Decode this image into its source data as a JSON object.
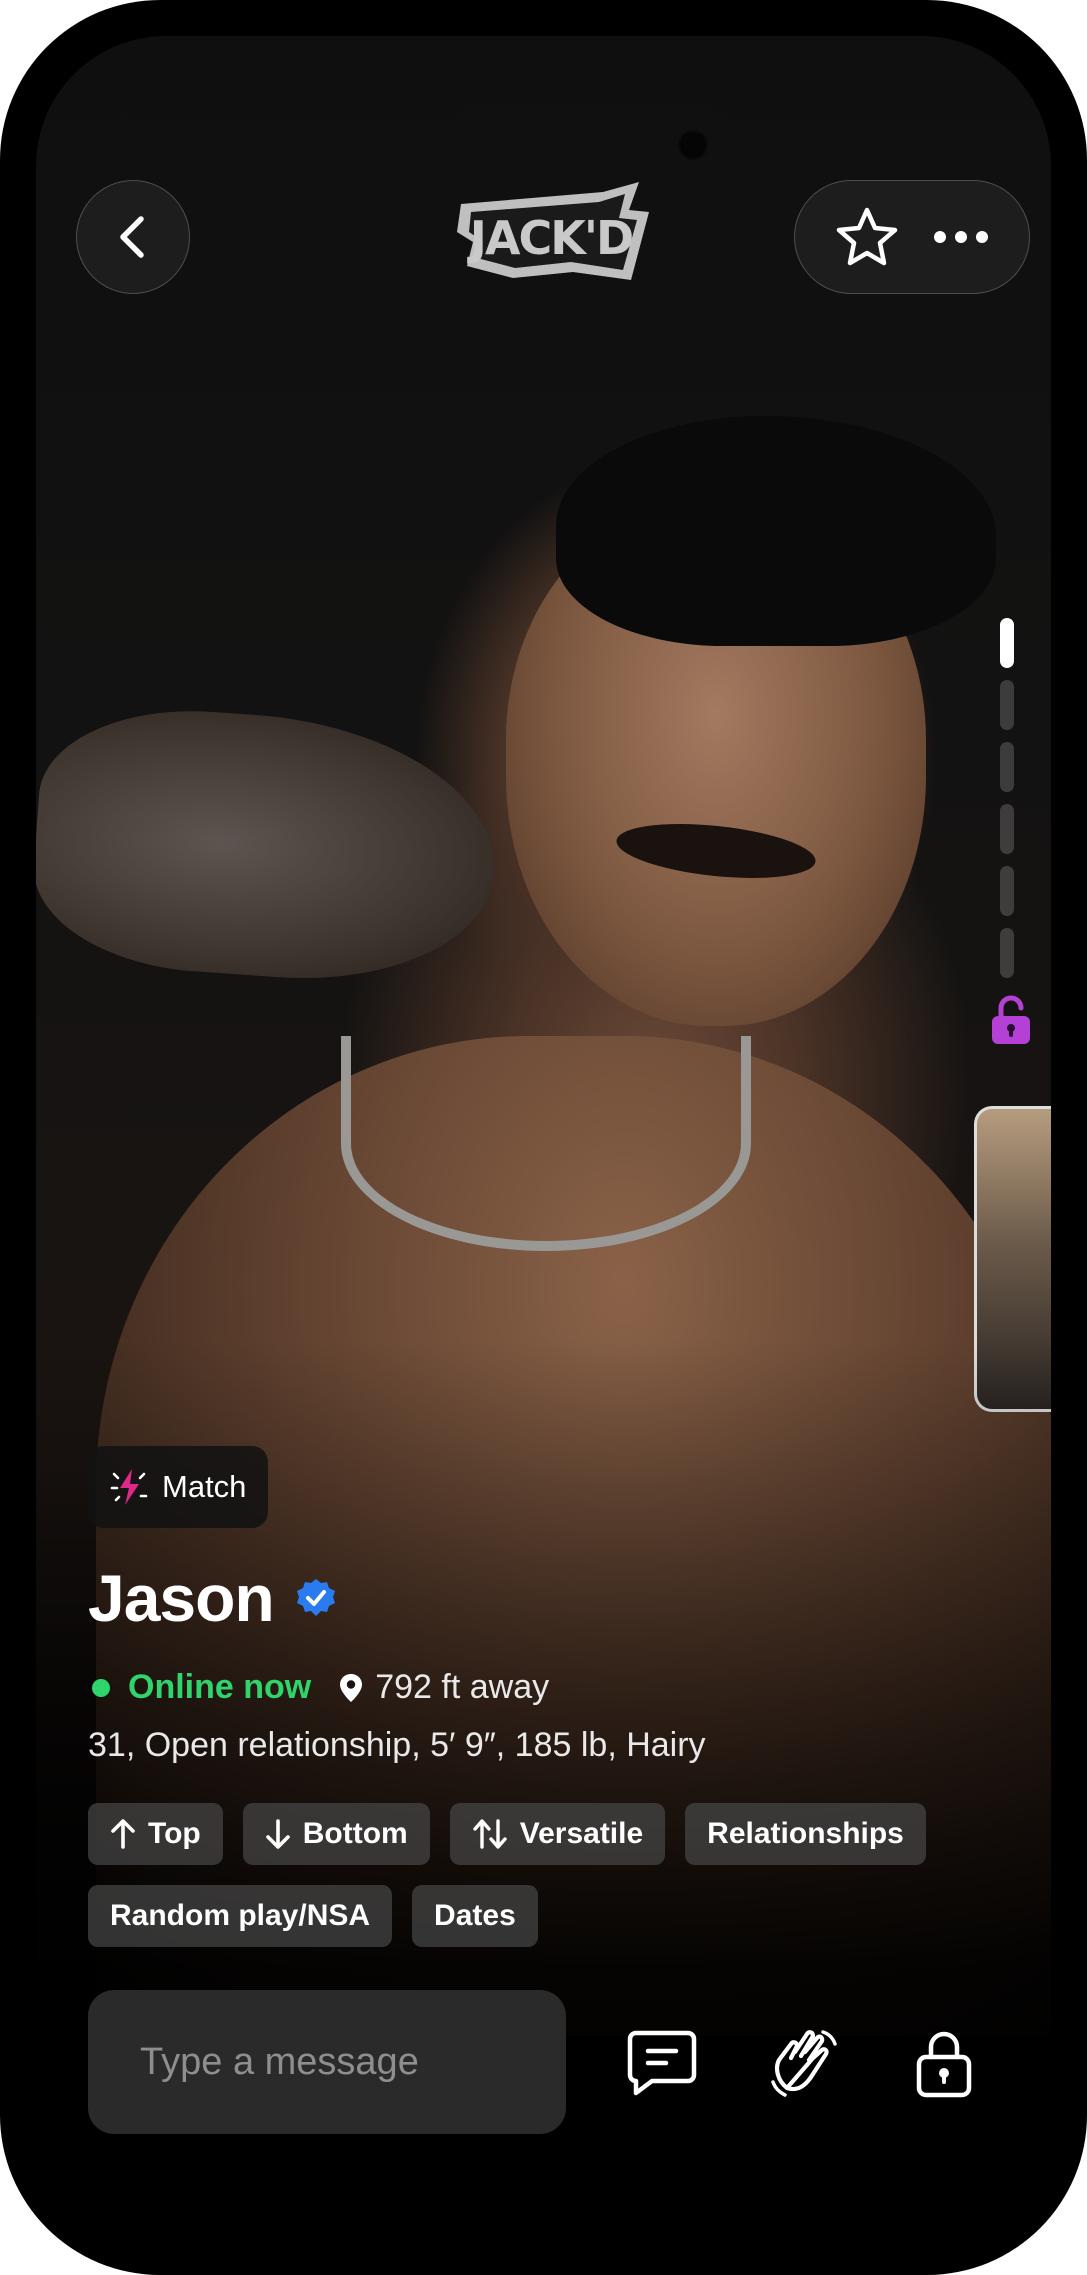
{
  "header": {
    "logo_text": "JACK'D"
  },
  "badge": {
    "label": "Match",
    "icon": "spark-icon",
    "icon_color": "#e0288a"
  },
  "profile": {
    "name": "Jason",
    "verified": true,
    "verified_color": "#2a7bf0",
    "online_status": "Online now",
    "online_color": "#2fd46b",
    "distance": "792 ft away",
    "stats": "31, Open relationship, 5′ 9″, 185 lb, Hairy"
  },
  "tags": [
    {
      "label": "Top",
      "icon": "arrow-up-icon"
    },
    {
      "label": "Bottom",
      "icon": "arrow-down-icon"
    },
    {
      "label": "Versatile",
      "icon": "arrows-up-down-icon"
    },
    {
      "label": "Relationships",
      "icon": ""
    },
    {
      "label": "Random play/NSA",
      "icon": ""
    },
    {
      "label": "Dates",
      "icon": ""
    }
  ],
  "gallery": {
    "photo_count": 7,
    "current_index": 1,
    "private_album_color": "#b440d6"
  },
  "composer": {
    "placeholder": "Type a message"
  }
}
